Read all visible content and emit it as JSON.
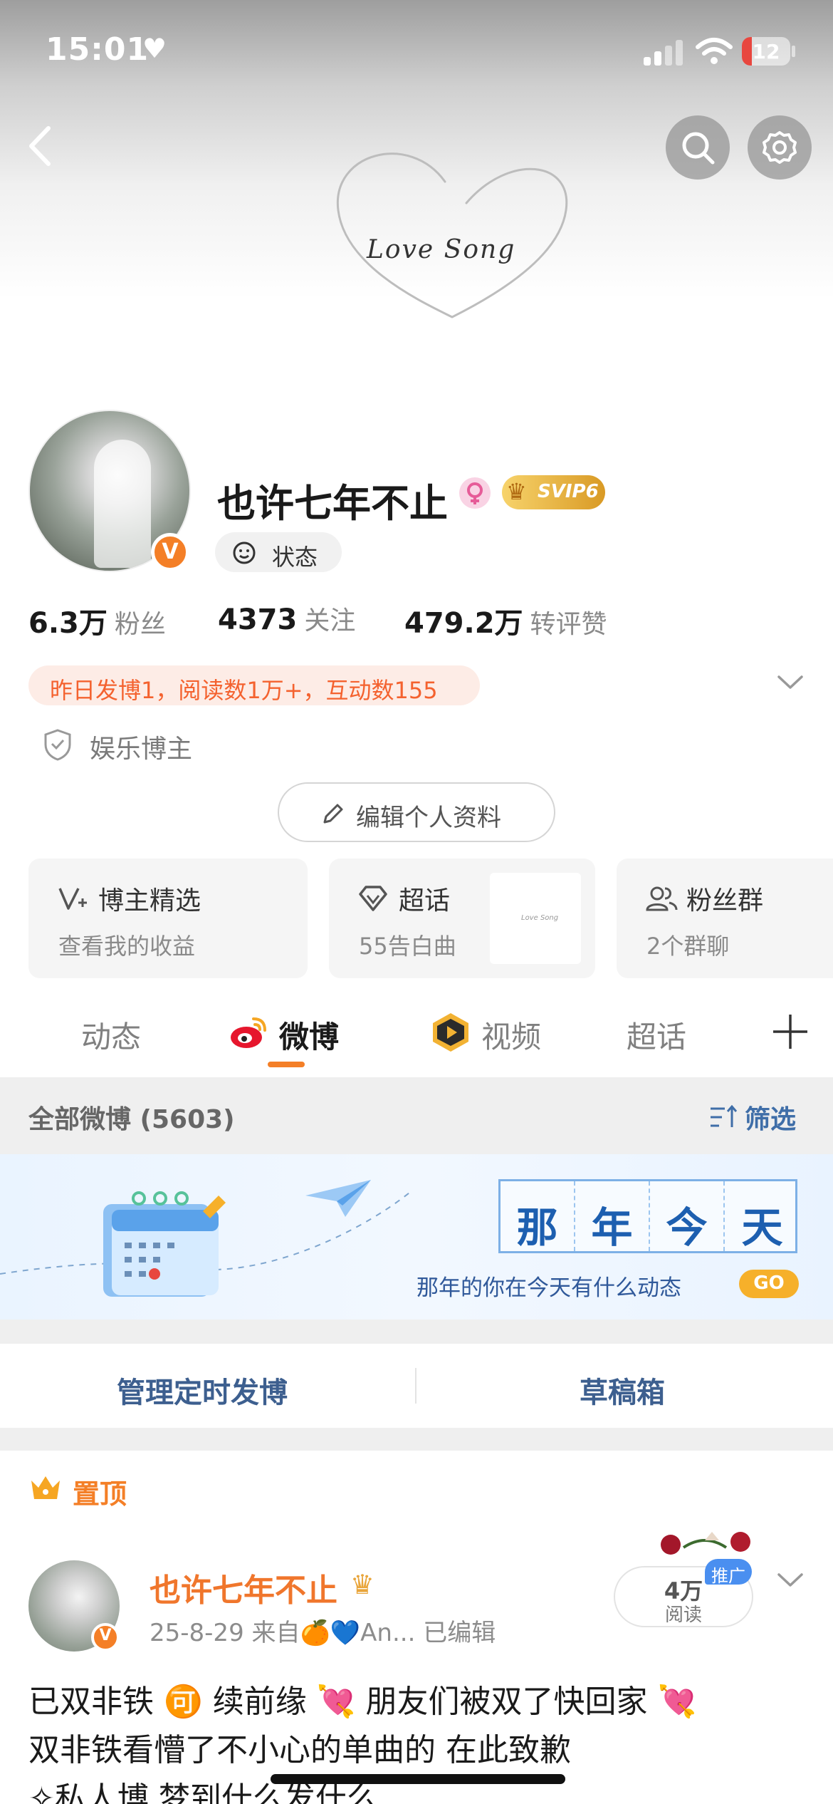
{
  "status_bar": {
    "time": "15:01",
    "battery": "12"
  },
  "cover": {
    "text": "Love Song"
  },
  "profile": {
    "nickname": "也许七年不止",
    "vip_label": "SVIP6",
    "verified_label": "V",
    "status_label": "状态",
    "stats": [
      {
        "num": "6.3万",
        "label": "粉丝"
      },
      {
        "num": "4373",
        "label": "关注"
      },
      {
        "num": "479.2万",
        "label": "转评赞"
      }
    ],
    "activity": "昨日发博1，阅读数1万+，互动数155",
    "category": "娱乐博主",
    "edit_button": "编辑个人资料"
  },
  "cards": [
    {
      "title": "博主精选",
      "sub": "查看我的收益"
    },
    {
      "title": "超话",
      "sub": "55告白曲",
      "thumb_text": "Love Song"
    },
    {
      "title": "粉丝群",
      "sub": "2个群聊"
    }
  ],
  "tabs": [
    "动态",
    "微博",
    "视频",
    "超话"
  ],
  "active_tab": "微博",
  "filter_bar": {
    "count": "全部微博 (5603)",
    "filter": "筛选"
  },
  "banner": {
    "chars": [
      "那",
      "年",
      "今",
      "天"
    ],
    "subtitle": "那年的你在今天有什么动态",
    "go": "GO"
  },
  "actions": {
    "left": "管理定时发博",
    "right": "草稿箱"
  },
  "pinned_label": "置顶",
  "post": {
    "author": "也许七年不止",
    "meta": "25-8-29  来自🍊💙An...  已编辑",
    "reads_num": "4万",
    "reads_label": "阅读",
    "promo": "推广",
    "lines": [
      "已双非铁 🉑 续前缘 💘 朋友们被双了快回家 💘",
      "双非铁看懵了不小心的单曲的 在此致歉",
      "✧私人博 梦到什么发什么"
    ]
  },
  "colors": {
    "accent": "#f47f27",
    "link_blue": "#3d5f8f",
    "banner_blue": "#1d5fb0"
  }
}
